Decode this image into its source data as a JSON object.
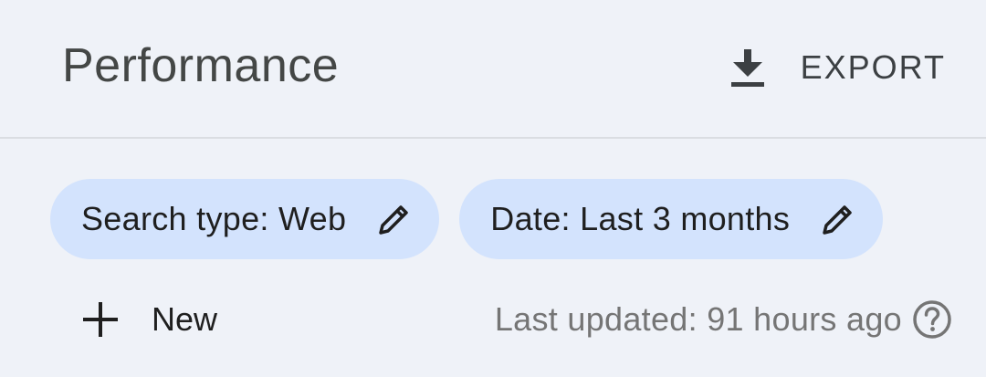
{
  "header": {
    "title": "Performance",
    "export_label": "EXPORT",
    "export_icon": "download-icon"
  },
  "filters": [
    {
      "label": "Search type: Web",
      "icon": "pencil-icon"
    },
    {
      "label": "Date: Last 3 months",
      "icon": "pencil-icon"
    }
  ],
  "actions": {
    "new_label": "New",
    "new_icon": "plus-icon"
  },
  "status": {
    "last_updated": "Last updated: 91 hours ago",
    "help_icon": "help-circle-icon"
  },
  "colors": {
    "background": "#eff2f8",
    "chip_background": "#d3e3fd",
    "title_text": "#444746",
    "muted_text": "#757575"
  }
}
